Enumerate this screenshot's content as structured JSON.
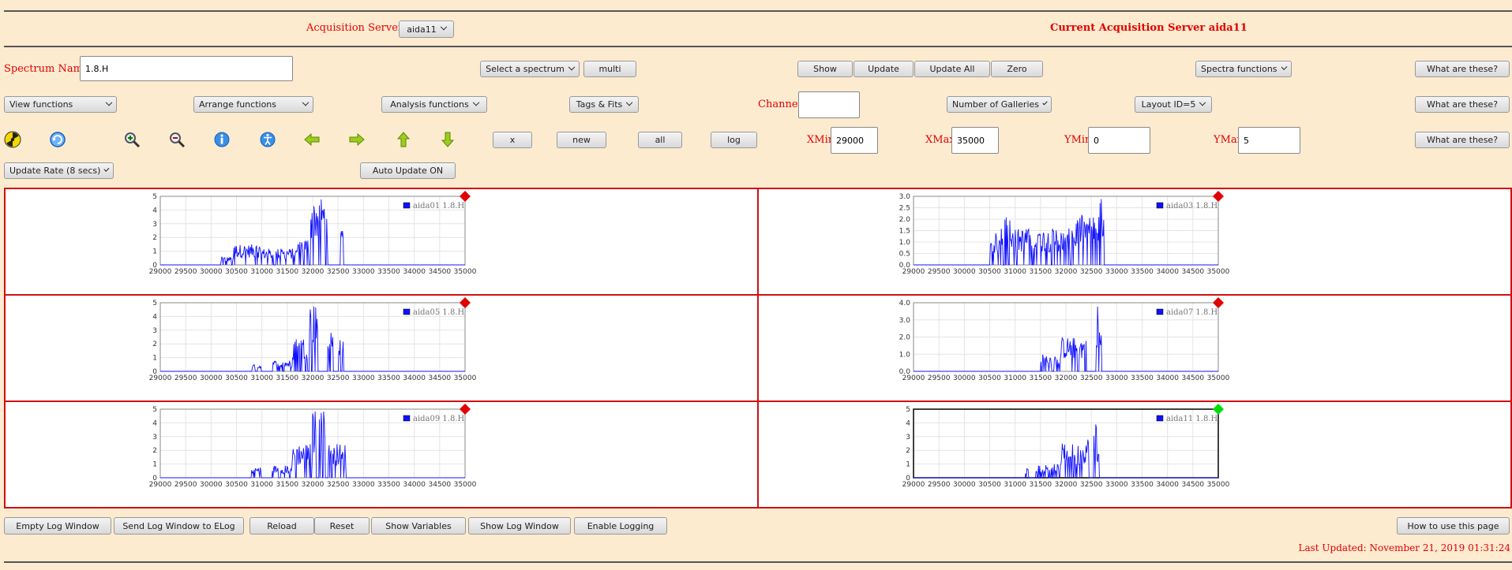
{
  "header": {
    "servers_label": "Acquisition Servers",
    "server_select": "aida11",
    "current_server": "Current Acquisition Server aida11"
  },
  "row1": {
    "spectrum_name_label": "Spectrum Name:",
    "spectrum_name_value": "1.8.H",
    "select_spectrum": "Select a spectrum",
    "multi": "multi",
    "show": "Show",
    "update": "Update",
    "update_all": "Update All",
    "zero": "Zero",
    "spectra_functions": "Spectra functions",
    "what": "What are these?"
  },
  "row2": {
    "view_functions": "View functions",
    "arrange_functions": "Arrange functions",
    "analysis_functions": "Analysis functions",
    "tags_fits": "Tags & Fits",
    "channel_label": "Channel:",
    "channel_value": "",
    "galleries": "Number of Galleries",
    "layout": "Layout ID=5",
    "what": "What are these?"
  },
  "row3": {
    "x": "x",
    "new": "new",
    "all": "all",
    "log": "log",
    "xmin_label": "XMin",
    "xmin_value": "29000",
    "xmax_label": "XMax",
    "xmax_value": "35000",
    "ymin_label": "YMin",
    "ymin_value": "0",
    "ymax_label": "YMax",
    "ymax_value": "5",
    "what": "What are these?"
  },
  "row4": {
    "update_rate": "Update Rate (8 secs)",
    "auto_update": "Auto Update ON"
  },
  "icons": [
    "radiation-icon",
    "refresh-icon",
    "zoom-in-icon",
    "zoom-out-icon",
    "info-circle-icon",
    "accessibility-icon",
    "arrow-left-icon",
    "arrow-right-icon",
    "arrow-up-icon",
    "arrow-down-icon"
  ],
  "footer": {
    "empty_log": "Empty Log Window",
    "send_log": "Send Log Window to ELog",
    "reload": "Reload",
    "reset": "Reset",
    "show_variables": "Show Variables",
    "show_log": "Show Log Window",
    "enable_logging": "Enable Logging",
    "how_to": "How to use this page",
    "last_updated": "Last Updated: November 21, 2019 01:31:24"
  },
  "colors": {
    "label_red": "#e00000",
    "panel_border": "#d01010",
    "series": "#1010ff",
    "status_red": "#e00000",
    "status_green": "#00dd00"
  },
  "chart_data": [
    {
      "type": "line",
      "legend": "aida01 1.8.H",
      "status": "red",
      "selected": false,
      "xlim": [
        29000,
        35000
      ],
      "ylim": [
        0,
        5
      ],
      "xticks": [
        "29000",
        "29500",
        "30000",
        "30500",
        "31000",
        "31500",
        "32000",
        "32500",
        "33000",
        "33500",
        "34000",
        "34500",
        "35000"
      ],
      "yticks": [
        "0",
        "1",
        "2",
        "3",
        "4",
        "5"
      ],
      "peaks": [
        {
          "from": 30200,
          "to": 30450,
          "level": 0.6
        },
        {
          "from": 30450,
          "to": 31000,
          "level": 1.5
        },
        {
          "from": 31000,
          "to": 31700,
          "level": 1.2
        },
        {
          "from": 31700,
          "to": 31950,
          "level": 2.0
        },
        {
          "from": 31950,
          "to": 32300,
          "level": 5.0
        },
        {
          "from": 32300,
          "to": 32800,
          "level": 0
        },
        {
          "from": 32550,
          "to": 32600,
          "level": 2.5
        }
      ]
    },
    {
      "type": "line",
      "legend": "aida03 1.8.H",
      "status": "red",
      "selected": false,
      "xlim": [
        29000,
        35000
      ],
      "ylim": [
        0,
        3
      ],
      "xticks": [
        "29000",
        "29500",
        "30000",
        "30500",
        "31000",
        "31500",
        "32000",
        "32500",
        "33000",
        "33500",
        "34000",
        "34500",
        "35000"
      ],
      "yticks": [
        "0.0",
        "0.5",
        "1.0",
        "1.5",
        "2.0",
        "2.5",
        "3.0"
      ],
      "peaks": [
        {
          "from": 30500,
          "to": 30700,
          "level": 1.4
        },
        {
          "from": 30700,
          "to": 31000,
          "level": 2.2
        },
        {
          "from": 31000,
          "to": 32200,
          "level": 1.6
        },
        {
          "from": 32200,
          "to": 32750,
          "level": 2.2
        },
        {
          "from": 32650,
          "to": 32700,
          "level": 3.0
        }
      ]
    },
    {
      "type": "line",
      "legend": "aida05 1.8.H",
      "status": "red",
      "selected": false,
      "xlim": [
        29000,
        35000
      ],
      "ylim": [
        0,
        5
      ],
      "xticks": [
        "29000",
        "29500",
        "30000",
        "30500",
        "31000",
        "31500",
        "32000",
        "32500",
        "33000",
        "33500",
        "34000",
        "34500",
        "35000"
      ],
      "yticks": [
        "0",
        "1",
        "2",
        "3",
        "4",
        "5"
      ],
      "peaks": [
        {
          "from": 30800,
          "to": 31000,
          "level": 0.5
        },
        {
          "from": 31200,
          "to": 31600,
          "level": 0.8
        },
        {
          "from": 31600,
          "to": 31900,
          "level": 2.5
        },
        {
          "from": 31900,
          "to": 32100,
          "level": 5.0
        },
        {
          "from": 32300,
          "to": 32400,
          "level": 3.0
        },
        {
          "from": 32500,
          "to": 32600,
          "level": 2.5
        }
      ]
    },
    {
      "type": "line",
      "legend": "aida07 1.8.H",
      "status": "red",
      "selected": false,
      "xlim": [
        29000,
        35000
      ],
      "ylim": [
        0,
        4
      ],
      "xticks": [
        "29000",
        "29500",
        "30000",
        "30500",
        "31000",
        "31500",
        "32000",
        "32500",
        "33000",
        "33500",
        "34000",
        "34500",
        "35000"
      ],
      "yticks": [
        "0.0",
        "1.0",
        "2.0",
        "3.0",
        "4.0"
      ],
      "peaks": [
        {
          "from": 31500,
          "to": 31900,
          "level": 1.0
        },
        {
          "from": 31900,
          "to": 32400,
          "level": 2.0
        },
        {
          "from": 32600,
          "to": 32650,
          "level": 4.0
        },
        {
          "from": 32650,
          "to": 32700,
          "level": 2.5
        }
      ]
    },
    {
      "type": "line",
      "legend": "aida09 1.8.H",
      "status": "red",
      "selected": false,
      "xlim": [
        29000,
        35000
      ],
      "ylim": [
        0,
        5
      ],
      "xticks": [
        "29000",
        "29500",
        "30000",
        "30500",
        "31000",
        "31500",
        "32000",
        "32500",
        "33000",
        "33500",
        "34000",
        "34500",
        "35000"
      ],
      "yticks": [
        "0",
        "1",
        "2",
        "3",
        "4",
        "5"
      ],
      "peaks": [
        {
          "from": 30800,
          "to": 31000,
          "level": 0.8
        },
        {
          "from": 31200,
          "to": 31600,
          "level": 0.9
        },
        {
          "from": 31600,
          "to": 32000,
          "level": 2.5
        },
        {
          "from": 32000,
          "to": 32250,
          "level": 5.0
        },
        {
          "from": 32300,
          "to": 32650,
          "level": 2.5
        }
      ]
    },
    {
      "type": "line",
      "legend": "aida11 1.8.H",
      "status": "green",
      "selected": true,
      "xlim": [
        29000,
        35000
      ],
      "ylim": [
        0,
        5
      ],
      "xticks": [
        "29000",
        "29500",
        "30000",
        "30500",
        "31000",
        "31500",
        "32000",
        "32500",
        "33000",
        "33500",
        "34000",
        "34500",
        "35000"
      ],
      "yticks": [
        "0",
        "1",
        "2",
        "3",
        "4",
        "5"
      ],
      "peaks": [
        {
          "from": 31200,
          "to": 31300,
          "level": 0.7
        },
        {
          "from": 31400,
          "to": 31900,
          "level": 1.0
        },
        {
          "from": 31900,
          "to": 32400,
          "level": 2.5
        },
        {
          "from": 32350,
          "to": 32450,
          "level": 3.0
        },
        {
          "from": 32550,
          "to": 32600,
          "level": 4.6
        },
        {
          "from": 32600,
          "to": 32650,
          "level": 2.0
        }
      ]
    }
  ]
}
